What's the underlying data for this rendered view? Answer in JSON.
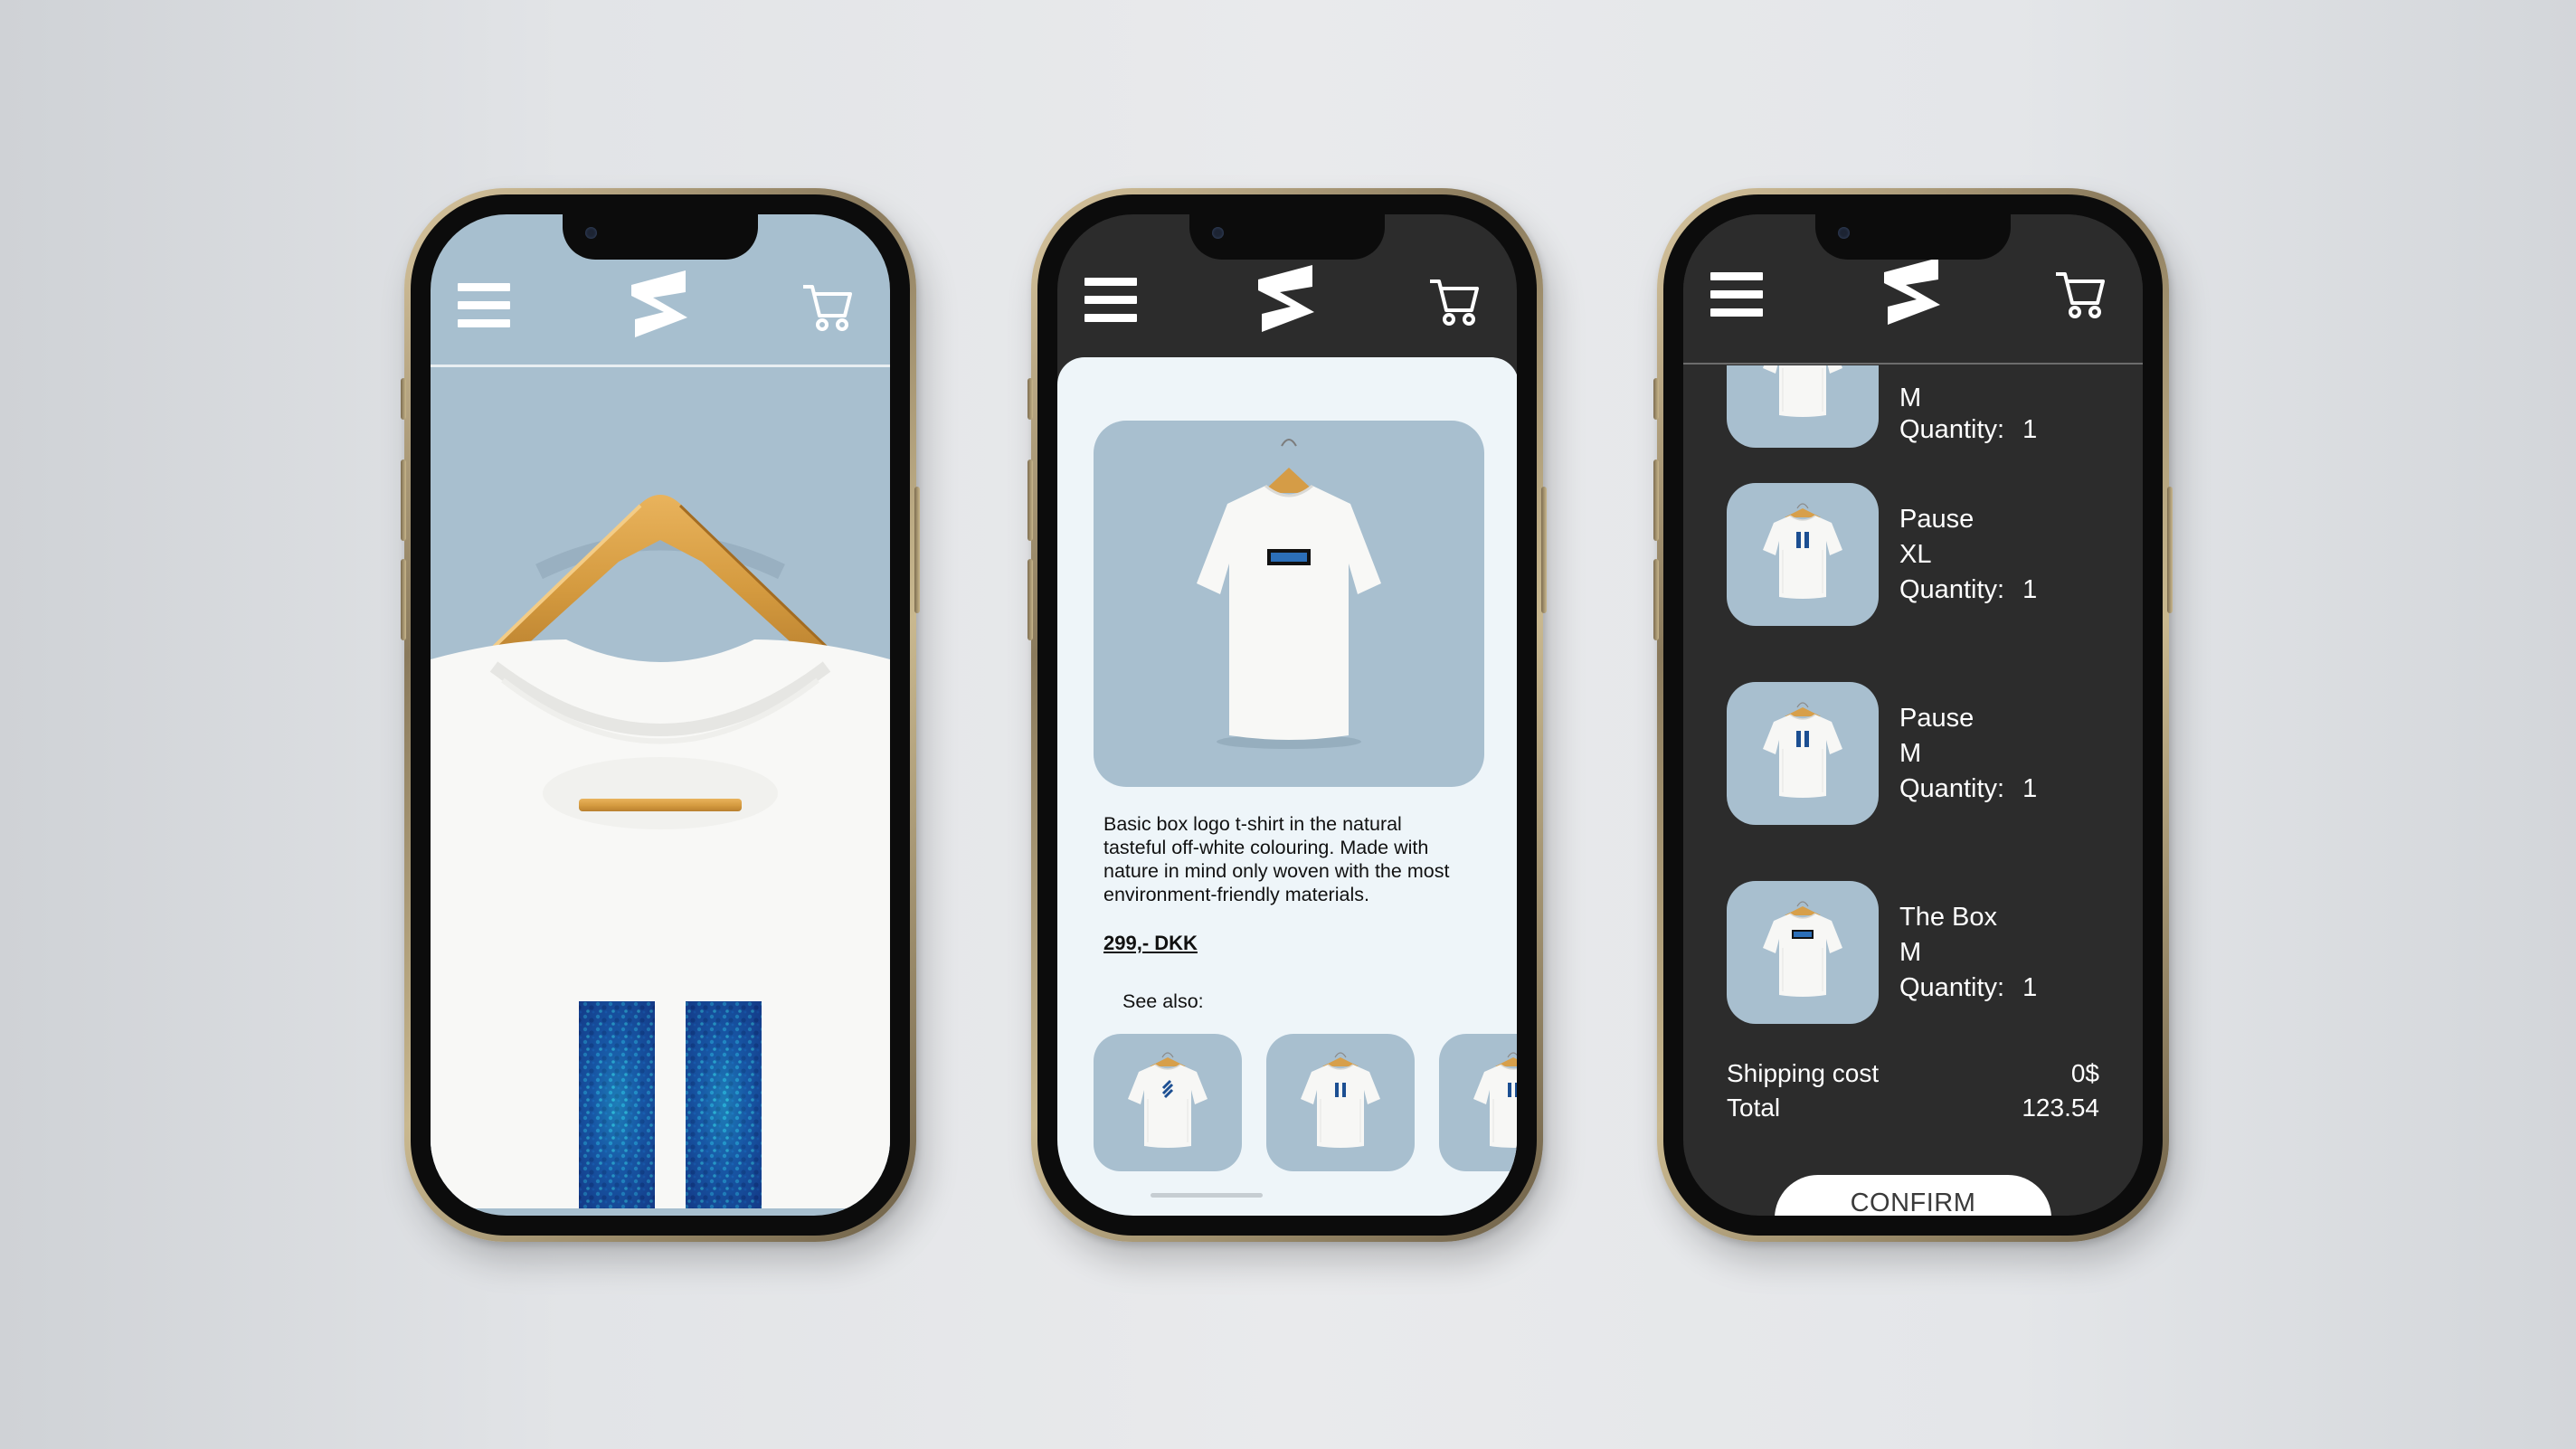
{
  "brand": {
    "logo_icon": "s-logo-icon"
  },
  "icons": {
    "menu": "hamburger-menu-icon",
    "cart": "shopping-cart-icon"
  },
  "colors": {
    "accent_blue": "#a6bdcd",
    "dark": "#2c2c2c",
    "detail_bg": "#eef5f9",
    "print_blue": "#1f4f8f"
  },
  "product": {
    "description": "Basic box logo t-shirt in the natural tasteful off-white colouring. Made with nature in mind only woven with the most environment-friendly materials.",
    "price": "299,- DKK",
    "see_also_label": "See also:"
  },
  "cart": {
    "items": [
      {
        "size": "M",
        "quantity_label": "Quantity:",
        "quantity": "1"
      },
      {
        "name": "Pause",
        "size": "XL",
        "quantity_label": "Quantity:",
        "quantity": "1"
      },
      {
        "name": "Pause",
        "size": "M",
        "quantity_label": "Quantity:",
        "quantity": "1"
      },
      {
        "name": "The Box",
        "size": "M",
        "quantity_label": "Quantity:",
        "quantity": "1"
      }
    ],
    "shipping_label": "Shipping cost",
    "shipping_value": "0$",
    "total_label": "Total",
    "total_value": "123.54",
    "confirm_label": "CONFIRM"
  }
}
